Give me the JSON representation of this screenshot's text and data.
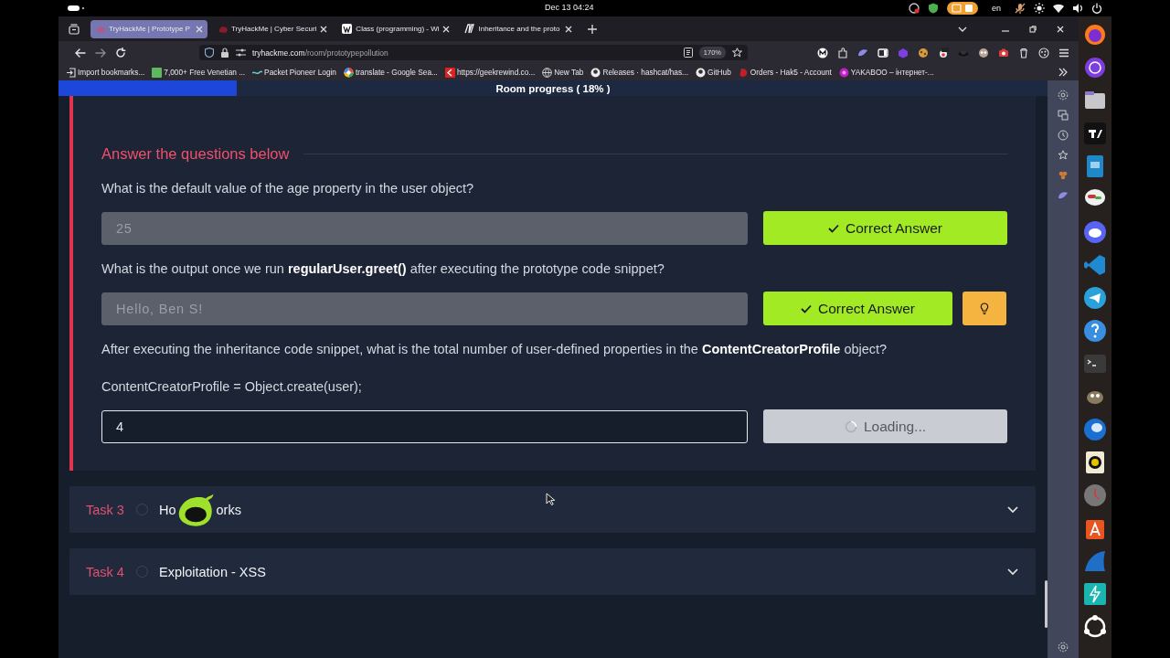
{
  "system_bar": {
    "clock": "Dec 13  04:24",
    "language": "en"
  },
  "browser": {
    "tabs": [
      {
        "title": "TryHackMe | Prototype P",
        "selected": true
      },
      {
        "title": "TryHackMe | Cyber Securi",
        "selected": false
      },
      {
        "title": "Class (programming) - Wi",
        "selected": false
      },
      {
        "title": "Inheritance and the proto",
        "selected": false
      }
    ],
    "url": {
      "host": "tryhackme.com",
      "path": "/room/prototypepollution"
    },
    "zoom": "170%",
    "bookmarks": [
      "Import bookmarks...",
      "7,000+ Free Venetian ...",
      "Packet Pioneer Login",
      "translate - Google Sea...",
      "https://geekrewind.co...",
      "New Tab",
      "Releases · hashcat/has...",
      "GitHub",
      "Orders - Hak5 - Account",
      "YAKABOO – інтернет-..."
    ]
  },
  "room_progress": {
    "label": "Room progress ( 18% )",
    "level": 0.18
  },
  "answers": {
    "heading": "Answer the questions below",
    "questions": [
      {
        "text": "What is the default value of the age property in the user object?",
        "answer": "25",
        "answered": true,
        "button": "Correct Answer",
        "hint": false
      },
      {
        "text": "What is the output once we run **regularUser.greet()** after executing the prototype code snippet?",
        "answer": "Hello, Ben S!",
        "answered": true,
        "button": "Correct Answer",
        "hint": true
      },
      {
        "text": "After executing the inheritance code snippet, what is the total number of user-defined properties in the **ContentCreatorProfile** object?",
        "note": "ContentCreatorProfile = Object.create(user);",
        "answer": "4",
        "answered": false,
        "button": "Loading...",
        "hint": false
      }
    ]
  },
  "tasks": [
    {
      "label": "Task 3",
      "title_parts": [
        "Ho",
        "orks"
      ],
      "done": false
    },
    {
      "label": "Task 4",
      "title_parts": [
        "Exploitation - XSS"
      ],
      "done": false
    }
  ]
}
